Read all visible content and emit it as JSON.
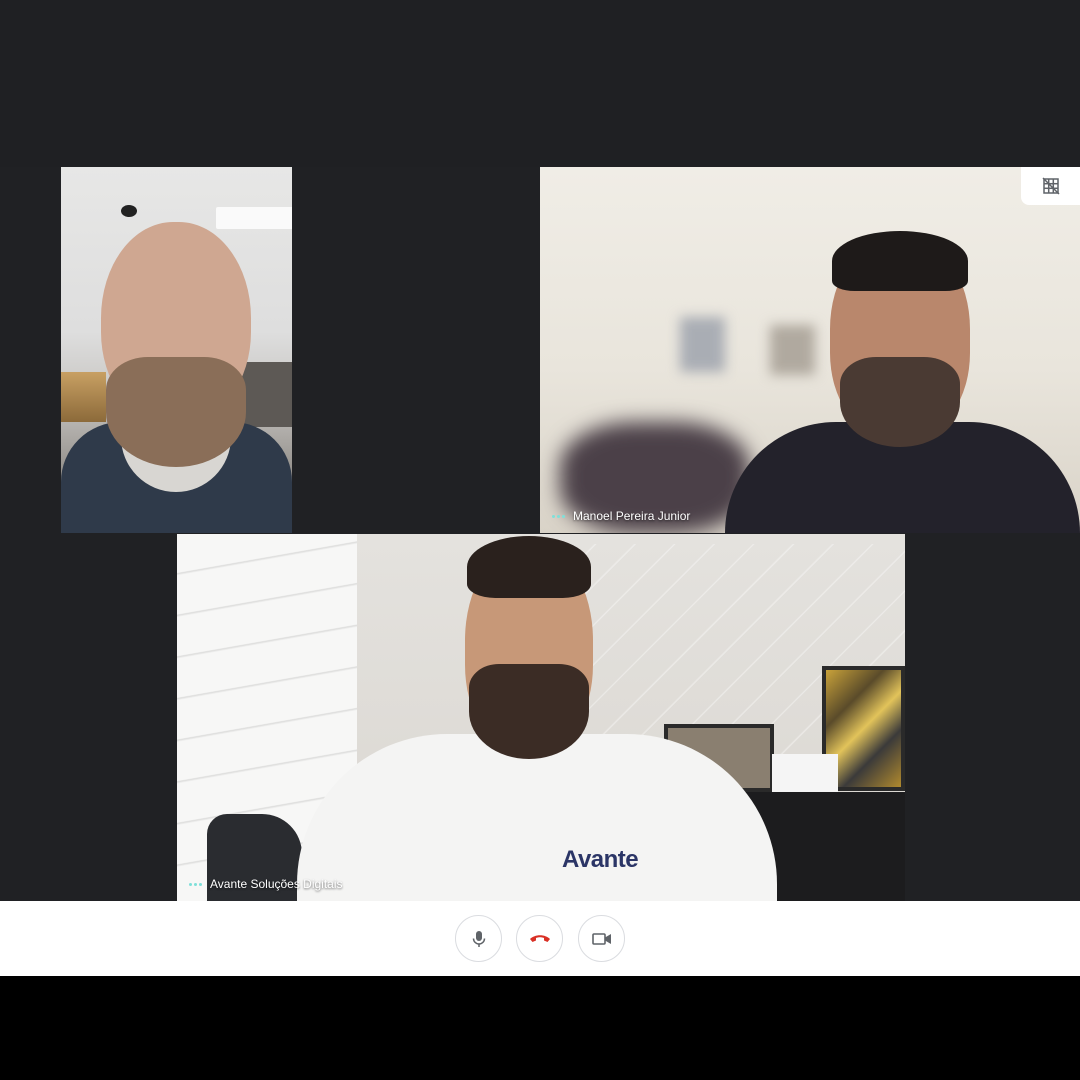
{
  "participants": [
    {
      "name": ""
    },
    {
      "name": "Manoel Pereira Junior"
    },
    {
      "name": "Avante Soluções Digitais"
    }
  ],
  "shirt_logo_text": "Avante",
  "controls": {
    "microphone": {
      "icon": "mic-icon"
    },
    "hang_up": {
      "icon": "phone-hangup-icon",
      "color": "#d93025"
    },
    "camera": {
      "icon": "video-camera-icon"
    }
  },
  "layout_toggle": {
    "icon": "grid-off-icon"
  },
  "colors": {
    "stage_background": "#202124",
    "control_bar": "#ffffff",
    "speaking_indicator": "#7ee0d9"
  }
}
